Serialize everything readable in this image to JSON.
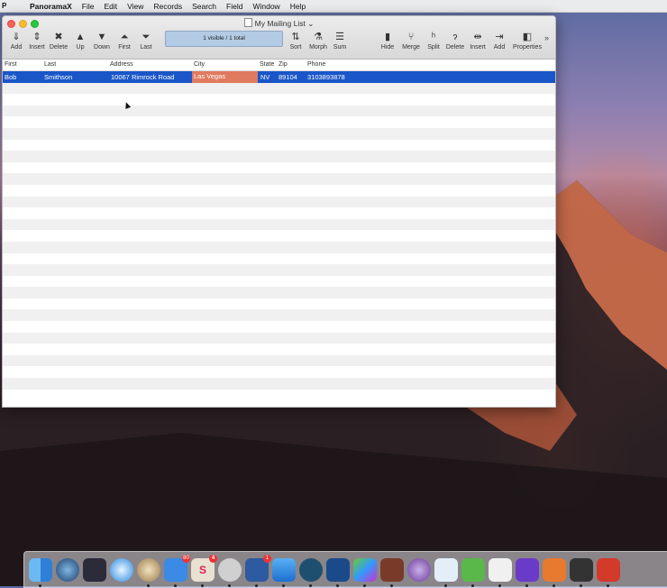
{
  "menubar": {
    "app_mark": "P",
    "app_name": "PanoramaX",
    "menus": [
      "File",
      "Edit",
      "View",
      "Records",
      "Search",
      "Field",
      "Window",
      "Help"
    ]
  },
  "window": {
    "title": "My Mailing List",
    "status": "1 visible / 1 total",
    "toolbar_left": [
      "Add",
      "Insert",
      "Delete",
      "Up",
      "Down",
      "First",
      "Last"
    ],
    "toolbar_mid": [
      "Sort",
      "Morph",
      "Sum"
    ],
    "toolbar_right": [
      "Hide",
      "Merge",
      "Split",
      "Delete",
      "Insert",
      "Add",
      "Properties"
    ]
  },
  "table": {
    "columns": [
      "First",
      "Last",
      "Address",
      "City",
      "State",
      "Zip",
      "Phone"
    ],
    "rows": [
      [
        "Bob",
        "Smithson",
        "10067 Rimrock Road",
        "Las Vegas",
        "NV",
        "89104",
        "3103893878"
      ]
    ]
  },
  "dock": {
    "badges": {
      "mail": "80",
      "slack": "4",
      "tasks": "1"
    }
  },
  "colors": {
    "selection": "#1a56c8",
    "city_highlight": "#e07a5f",
    "status_bar": "#b3cbe4"
  }
}
